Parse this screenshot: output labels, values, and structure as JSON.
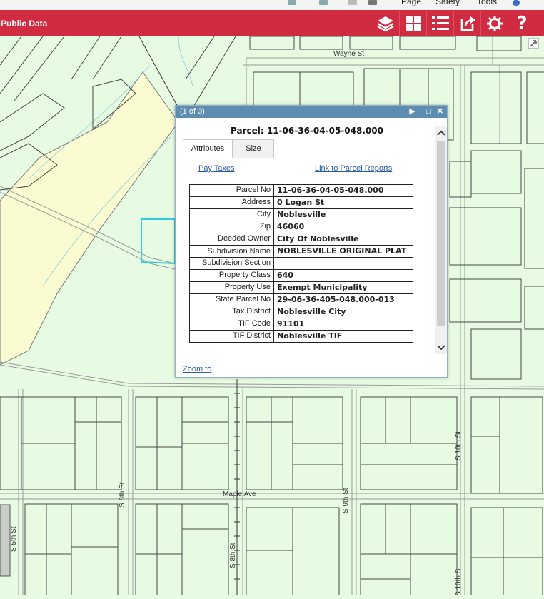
{
  "browser_toolbar": {
    "page_label": "Page",
    "safety_label": "Safety",
    "tools_label": "Tools"
  },
  "app": {
    "title": "Public Data"
  },
  "toolbar_icons": [
    "layers-icon",
    "basemap-grid-icon",
    "legend-list-icon",
    "share-icon",
    "settings-gear-icon",
    "help-icon"
  ],
  "map": {
    "street_labels": {
      "wayne": "Wayne St",
      "maple": "Maple Ave",
      "s5th": "S 5th St",
      "s6th": "S 6th St",
      "s8th": "S 8th St",
      "s9th": "S 9th St",
      "s10th": "S 10th St",
      "s10th_b": "S 10th St"
    },
    "colors": {
      "background": "#e7fbe3",
      "river": "#fbfbd2",
      "parcel_line": "#555555",
      "selection": "#33ccdd"
    }
  },
  "popup": {
    "count": "(1 of 3)",
    "title": "Parcel: 11-06-36-04-05-048.000",
    "tabs": [
      {
        "label": "Attributes"
      },
      {
        "label": "Size"
      }
    ],
    "links": {
      "pay_taxes": "Pay Taxes",
      "parcel_reports": "Link to Parcel Reports"
    },
    "attributes": [
      {
        "label": "Parcel No",
        "value": "11-06-36-04-05-048.000"
      },
      {
        "label": "Address",
        "value": "0 Logan St"
      },
      {
        "label": "City",
        "value": "Noblesville"
      },
      {
        "label": "Zip",
        "value": "46060"
      },
      {
        "label": "Deeded Owner",
        "value": "City Of Noblesville"
      },
      {
        "label": "Subdivision Name",
        "value": "NOBLESVILLE ORIGINAL PLAT"
      },
      {
        "label": "Subdivision Section",
        "value": ""
      },
      {
        "label": "Property Class",
        "value": "640"
      },
      {
        "label": "Property Use",
        "value": "Exempt Municipality"
      },
      {
        "label": "State Parcel No",
        "value": "29-06-36-405-048.000-013"
      },
      {
        "label": "Tax District",
        "value": "Noblesville City"
      },
      {
        "label": "TIF Code",
        "value": "91101"
      },
      {
        "label": "TIF District",
        "value": "Noblesville TIF"
      }
    ],
    "zoom_to": "Zoom to"
  }
}
